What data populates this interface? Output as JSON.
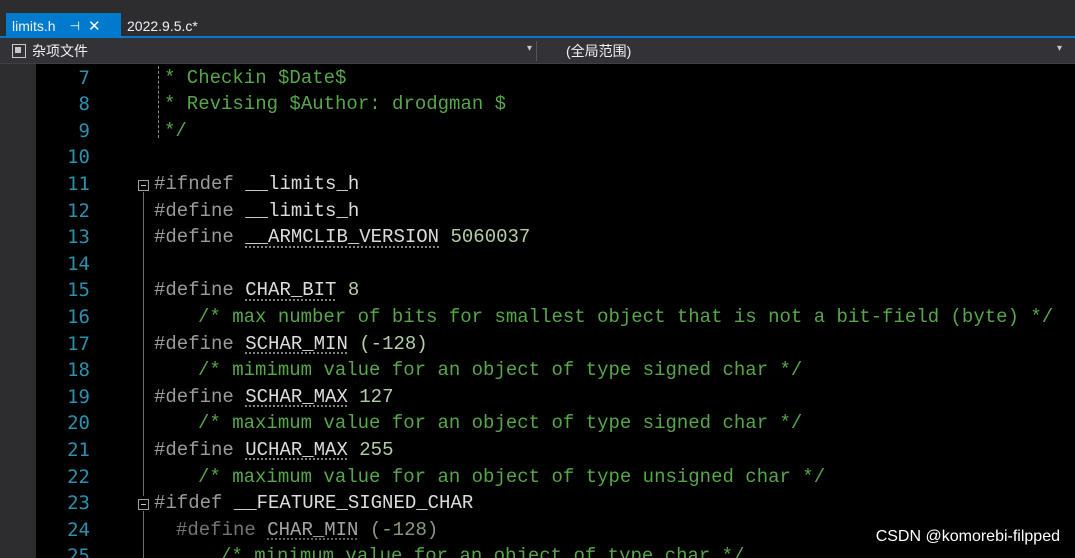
{
  "tabs": [
    {
      "label": "limits.h",
      "active": true
    },
    {
      "label": "2022.9.5.c*",
      "active": false
    }
  ],
  "nav": {
    "project": "杂项文件",
    "scope": "(全局范围)"
  },
  "lines": [
    {
      "n": "7",
      "text": "* Checkin $Date$"
    },
    {
      "n": "8",
      "text": "* Revising $Author: drodgman $"
    },
    {
      "n": "9",
      "text": "*/"
    },
    {
      "n": "10",
      "text": ""
    },
    {
      "n": "11",
      "pre": "#ifndef",
      "name": "__limits_h"
    },
    {
      "n": "12",
      "pre": "#define",
      "name": "__limits_h"
    },
    {
      "n": "13",
      "pre": "#define",
      "name": "__ARMCLIB_VERSION",
      "val": "5060037"
    },
    {
      "n": "14",
      "text": ""
    },
    {
      "n": "15",
      "pre": "#define",
      "name": "CHAR_BIT",
      "val": "8"
    },
    {
      "n": "16",
      "comment": "/* max number of bits for smallest object that is not a bit-field (byte) */"
    },
    {
      "n": "17",
      "pre": "#define",
      "name": "SCHAR_MIN",
      "val": "(-128)"
    },
    {
      "n": "18",
      "comment": "/* mimimum value for an object of type signed char */"
    },
    {
      "n": "19",
      "pre": "#define",
      "name": "SCHAR_MAX",
      "val": "127"
    },
    {
      "n": "20",
      "comment": "/* maximum value for an object of type signed char */"
    },
    {
      "n": "21",
      "pre": "#define",
      "name": "UCHAR_MAX",
      "val": "255"
    },
    {
      "n": "22",
      "comment": "/* maximum value for an object of type unsigned char */"
    },
    {
      "n": "23",
      "pre": "#ifdef",
      "name": "__FEATURE_SIGNED_CHAR"
    },
    {
      "n": "24",
      "pre": "#define",
      "name": "CHAR_MIN",
      "val": "(-128)"
    },
    {
      "n": "25",
      "comment": "/* minimum value for an object of type char */"
    }
  ],
  "watermark": "CSDN @komorebi-filpped"
}
